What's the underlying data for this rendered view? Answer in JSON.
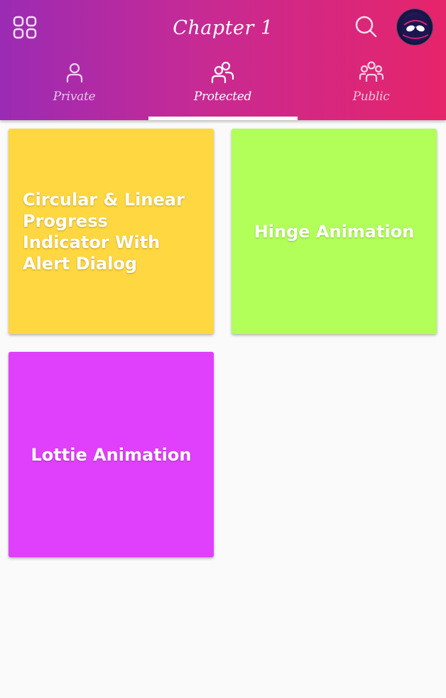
{
  "header": {
    "title": "Chapter 1",
    "menu_icon": "grid-icon",
    "search_icon": "search-icon",
    "avatar_icon": "avatar"
  },
  "tabs": [
    {
      "label": "Private",
      "icon": "person-icon",
      "active": false
    },
    {
      "label": "Protected",
      "icon": "group-icon",
      "active": true
    },
    {
      "label": "Public",
      "icon": "people-icon",
      "active": false
    }
  ],
  "cards": [
    {
      "title": "Circular & Linear Progress Indicator With Alert Dialog",
      "color": "#ffd740"
    },
    {
      "title": "Hinge Animation",
      "color": "#b2ff59"
    },
    {
      "title": "Lottie Animation",
      "color": "#e040fb"
    }
  ],
  "colors": {
    "header_gradient_start": "#9b2bb4",
    "header_gradient_end": "#e6246a",
    "background": "#fafafa"
  }
}
